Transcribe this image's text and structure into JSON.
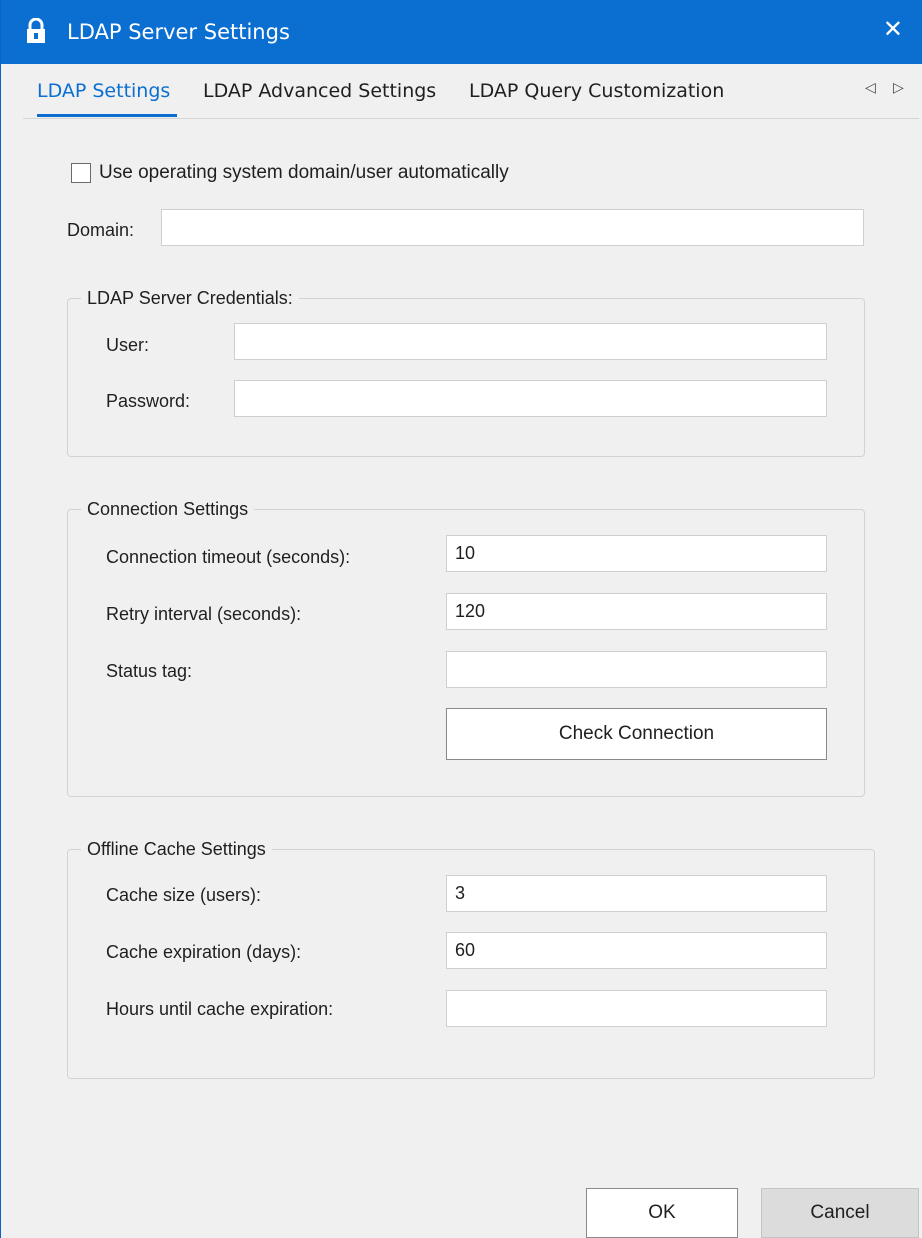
{
  "window": {
    "title": "LDAP Server Settings",
    "close_glyph": "✕",
    "accent": "#0a6fd1"
  },
  "tabs": {
    "items": [
      {
        "label": "LDAP Settings",
        "active": true
      },
      {
        "label": "LDAP Advanced Settings",
        "active": false
      },
      {
        "label": "LDAP Query Customization",
        "active": false
      }
    ],
    "prev_glyph": "◁",
    "next_glyph": "▷"
  },
  "main": {
    "use_os_domain": {
      "label": "Use operating system domain/user automatically",
      "checked": false
    },
    "domain": {
      "label": "Domain:",
      "value": ""
    }
  },
  "credentials": {
    "legend": "LDAP Server Credentials:",
    "user_label": "User:",
    "user_value": "",
    "password_label": "Password:",
    "password_value": ""
  },
  "connection": {
    "legend": "Connection Settings",
    "timeout_label": "Connection timeout (seconds):",
    "timeout_value": "10",
    "retry_label": "Retry interval (seconds):",
    "retry_value": "120",
    "status_label": "Status tag:",
    "status_value": "",
    "check_button": "Check Connection"
  },
  "cache": {
    "legend": "Offline Cache Settings",
    "size_label": "Cache size (users):",
    "size_value": "3",
    "expiration_label": "Cache expiration (days):",
    "expiration_value": "60",
    "hours_label": "Hours until cache expiration:",
    "hours_value": ""
  },
  "footer": {
    "ok_label": "OK",
    "cancel_label": "Cancel"
  }
}
